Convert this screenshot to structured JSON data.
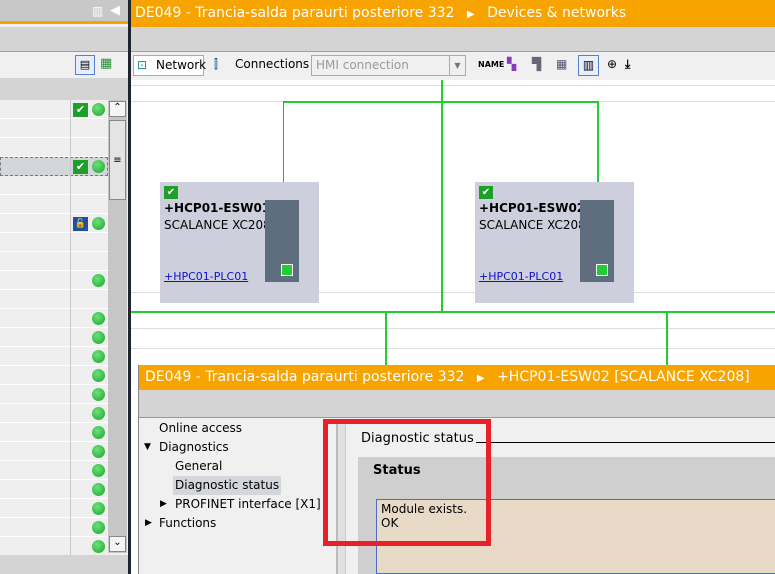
{
  "editor": {
    "title": "DE049 - Trancia-salda paraurti posteriore 332",
    "breadcrumb": "Devices & networks"
  },
  "toolbar": {
    "network": "Network",
    "connections": "Connections",
    "hmi_connection": "HMI connection"
  },
  "devices": [
    {
      "name": "+HCP01-ESW01",
      "type": "SCALANCE XC208",
      "link": "+HPC01-PLC01"
    },
    {
      "name": "+HCP01-ESW02",
      "type": "SCALANCE XC208",
      "link": "+HPC01-PLC01"
    }
  ],
  "dialog": {
    "title": "DE049 - Trancia-salda paraurti posteriore 332",
    "device": "+HCP01-ESW02 [SCALANCE XC208]",
    "nav": [
      "Online access",
      "Diagnostics",
      "General",
      "Diagnostic status",
      "PROFINET interface [X1]",
      "Functions"
    ],
    "section": "Diagnostic status",
    "status_label": "Status",
    "status_lines": [
      "Module exists.",
      "OK"
    ]
  },
  "colors": {
    "accent": "#f7a400",
    "ok": "#22cc33",
    "highlight": "#e8202a"
  }
}
